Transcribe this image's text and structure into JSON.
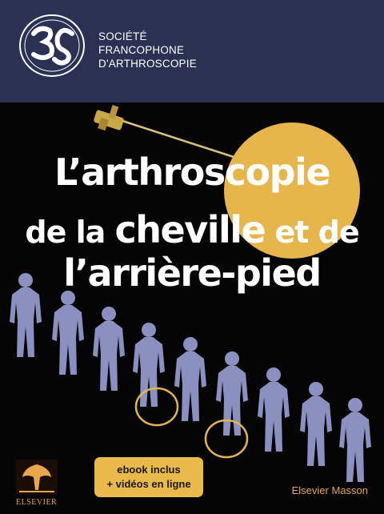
{
  "society": {
    "lines": [
      "SOCIÉTÉ",
      "FRANCOPHONE",
      "D'ARTHROSCOPIE"
    ]
  },
  "title": {
    "line1": "L’arthroscopie",
    "line2_a": "de la ",
    "line2_b": "cheville",
    "line2_c": " et de",
    "line3": "l’arrière-pied"
  },
  "badge": {
    "line1": "ebook inclus",
    "line2": "+ vidéos en ligne"
  },
  "publisher": "Elsevier Masson",
  "elsevier_logo_text": "ELSEVIER",
  "colors": {
    "header_bg": "#2a3152",
    "accent_gold": "#e6b64d",
    "figure_color": "#8a90c0",
    "publisher_orange": "#e9a64a"
  }
}
